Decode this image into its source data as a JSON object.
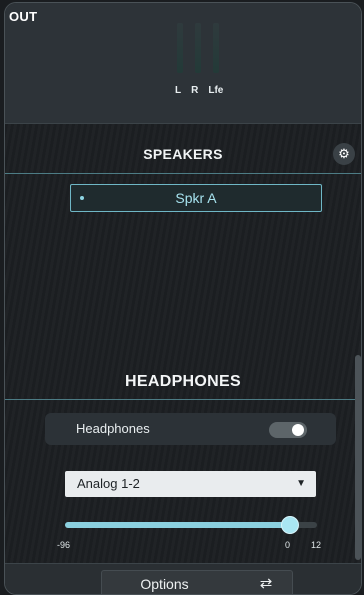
{
  "output": {
    "title": "OUT",
    "channel_labels": [
      "L",
      "R",
      "Lfe"
    ]
  },
  "speakers": {
    "title": "SPEAKERS",
    "settings_icon": "gear-icon",
    "selected": "Spkr A"
  },
  "headphones": {
    "title": "HEADPHONES",
    "toggle_label": "Headphones",
    "toggle_on": true,
    "source": "Analog 1-2",
    "level": {
      "min": -96,
      "max": 12,
      "value": 0,
      "ticks": [
        "-96",
        "0",
        "12"
      ]
    }
  },
  "footer": {
    "options_label": "Options",
    "options_icon": "cycle-icon"
  },
  "colors": {
    "accent": "#8bd0df",
    "selected_border": "#6fb7c6"
  }
}
